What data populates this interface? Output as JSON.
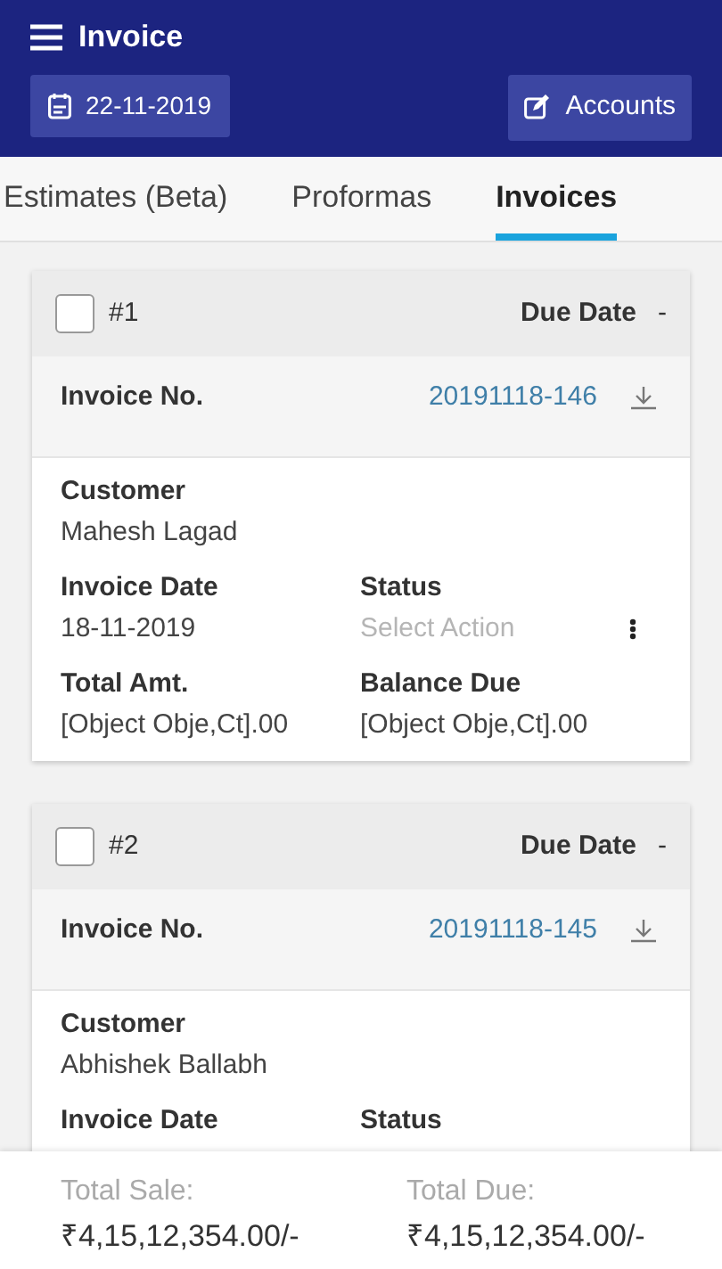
{
  "header": {
    "title": "Invoice",
    "date_button": "22-11-2019",
    "accounts_button": "Accounts"
  },
  "tabs": [
    {
      "label": "Estimates (Beta)",
      "selected": false
    },
    {
      "label": "Proformas",
      "selected": false
    },
    {
      "label": "Invoices",
      "selected": true
    }
  ],
  "invoices": [
    {
      "number": "#1",
      "checked": false,
      "due_label": "Due Date",
      "due_value": "-",
      "invoice_no_label": "Invoice No.",
      "invoice_no": "20191118-146",
      "customer_label": "Customer",
      "customer": "Mahesh Lagad",
      "rows": [
        [
          {
            "label": "Invoice Date",
            "value": "18-11-2019",
            "kind": "text"
          },
          {
            "label": "Status",
            "placeholder": "Select Action",
            "kind": "action"
          }
        ],
        [
          {
            "label": "Total Amt.",
            "value": "[Object Obje,Ct].00",
            "kind": "text"
          },
          {
            "label": "Balance Due",
            "value": "[Object Obje,Ct].00",
            "kind": "text"
          }
        ]
      ]
    },
    {
      "number": "#2",
      "checked": false,
      "due_label": "Due Date",
      "due_value": "-",
      "invoice_no_label": "Invoice No.",
      "invoice_no": "20191118-145",
      "customer_label": "Customer",
      "customer": "Abhishek Ballabh",
      "rows": [
        [
          {
            "label": "Invoice Date"
          },
          {
            "label": "Status"
          }
        ]
      ]
    }
  ],
  "footer": {
    "total_sale_label": "Total Sale:",
    "total_sale": "₹4,15,12,354.00/-",
    "total_due_label": "Total Due:",
    "total_due": "₹4,15,12,354.00/-"
  }
}
